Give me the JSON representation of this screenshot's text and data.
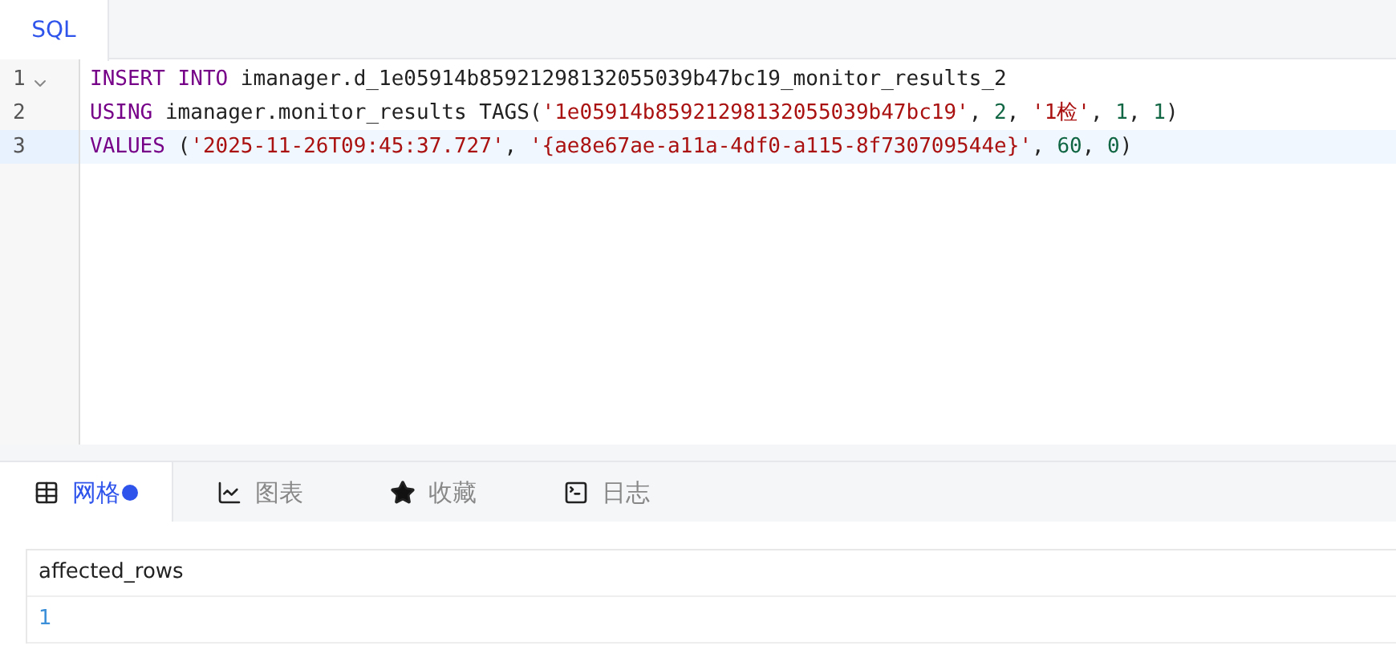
{
  "editor_tabs": [
    {
      "label": "SQL",
      "selected": true
    }
  ],
  "code_lines": [
    {
      "number": "1",
      "foldable": true,
      "active": false,
      "tokens": [
        {
          "kind": "keyword",
          "text": "INSERT INTO"
        },
        {
          "kind": "plain",
          "text": " imanager.d_1e05914b85921298132055039b47bc19_monitor_results_2"
        }
      ]
    },
    {
      "number": "2",
      "foldable": false,
      "active": false,
      "tokens": [
        {
          "kind": "keyword",
          "text": "USING"
        },
        {
          "kind": "plain",
          "text": " imanager.monitor_results TAGS("
        },
        {
          "kind": "string",
          "text": "'1e05914b85921298132055039b47bc19'"
        },
        {
          "kind": "plain",
          "text": ", "
        },
        {
          "kind": "number",
          "text": "2"
        },
        {
          "kind": "plain",
          "text": ", "
        },
        {
          "kind": "string",
          "text": "'1检'"
        },
        {
          "kind": "plain",
          "text": ", "
        },
        {
          "kind": "number",
          "text": "1"
        },
        {
          "kind": "plain",
          "text": ", "
        },
        {
          "kind": "number",
          "text": "1"
        },
        {
          "kind": "plain",
          "text": ")"
        }
      ]
    },
    {
      "number": "3",
      "foldable": false,
      "active": true,
      "tokens": [
        {
          "kind": "keyword",
          "text": "VALUES"
        },
        {
          "kind": "plain",
          "text": " ("
        },
        {
          "kind": "string",
          "text": "'2025-11-26T09:45:37.727'"
        },
        {
          "kind": "plain",
          "text": ", "
        },
        {
          "kind": "string",
          "text": "'{ae8e67ae-a11a-4df0-a115-8f730709544e}'"
        },
        {
          "kind": "plain",
          "text": ", "
        },
        {
          "kind": "number",
          "text": "60"
        },
        {
          "kind": "plain",
          "text": ", "
        },
        {
          "kind": "number",
          "text": "0"
        },
        {
          "kind": "plain",
          "text": ")"
        }
      ]
    }
  ],
  "result_tabs": [
    {
      "label": "网格",
      "kind": "grid",
      "selected": true,
      "info": true
    },
    {
      "label": "图表",
      "kind": "chart",
      "selected": false,
      "info": false
    },
    {
      "label": "收藏",
      "kind": "star",
      "selected": false,
      "info": false
    },
    {
      "label": "日志",
      "kind": "log",
      "selected": false,
      "info": false
    }
  ],
  "table": {
    "columns": [
      "affected_rows"
    ],
    "rows": [
      [
        "1"
      ]
    ]
  }
}
